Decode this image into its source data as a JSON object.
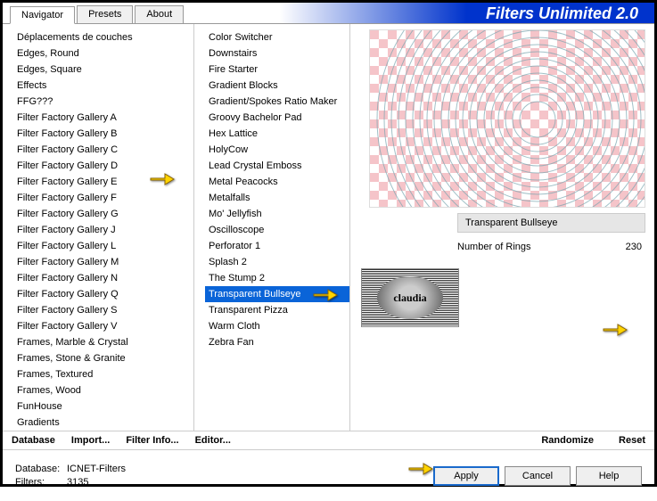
{
  "app": {
    "title": "Filters Unlimited 2.0"
  },
  "tabs": [
    {
      "label": "Navigator",
      "active": true
    },
    {
      "label": "Presets",
      "active": false
    },
    {
      "label": "About",
      "active": false
    }
  ],
  "categories": [
    "Déplacements de couches",
    "Edges, Round",
    "Edges, Square",
    "Effects",
    "FFG???",
    "Filter Factory Gallery A",
    "Filter Factory Gallery B",
    "Filter Factory Gallery C",
    "Filter Factory Gallery D",
    "Filter Factory Gallery E",
    "Filter Factory Gallery F",
    "Filter Factory Gallery G",
    "Filter Factory Gallery J",
    "Filter Factory Gallery L",
    "Filter Factory Gallery M",
    "Filter Factory Gallery N",
    "Filter Factory Gallery Q",
    "Filter Factory Gallery S",
    "Filter Factory Gallery V",
    "Frames, Marble & Crystal",
    "Frames, Stone & Granite",
    "Frames, Textured",
    "Frames, Wood",
    "FunHouse",
    "Gradients"
  ],
  "categories_selected_index": 9,
  "filters": [
    "Color Switcher",
    "Downstairs",
    "Fire Starter",
    "Gradient Blocks",
    "Gradient/Spokes Ratio Maker",
    "Groovy Bachelor Pad",
    "Hex Lattice",
    "HolyCow",
    "Lead Crystal Emboss",
    "Metal Peacocks",
    "Metalfalls",
    "Mo' Jellyfish",
    "Oscilloscope",
    "Perforator 1",
    "Splash 2",
    "The Stump 2",
    "Transparent Bullseye",
    "Transparent Pizza",
    "Warm Cloth",
    "Zebra Fan"
  ],
  "filters_selected_index": 16,
  "selected_filter_name": "Transparent Bullseye",
  "param": {
    "label": "Number of Rings",
    "value": "230"
  },
  "toolbar": {
    "database": "Database",
    "import": "Import...",
    "filter_info": "Filter Info...",
    "editor": "Editor...",
    "randomize": "Randomize",
    "reset": "Reset"
  },
  "footer": {
    "database_label": "Database:",
    "database_value": "ICNET-Filters",
    "filters_label": "Filters:",
    "filters_value": "3135",
    "apply": "Apply",
    "cancel": "Cancel",
    "help": "Help"
  },
  "logo_text": "claudia"
}
